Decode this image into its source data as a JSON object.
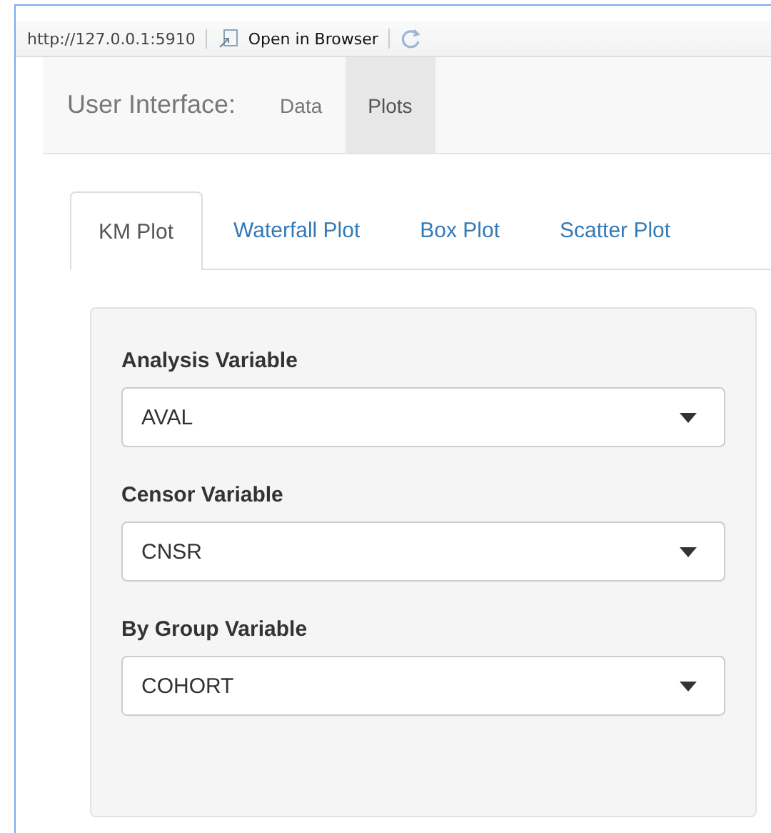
{
  "toolbar": {
    "url": "http://127.0.0.1:5910",
    "open_button": "Open in Browser"
  },
  "navbar": {
    "brand": "User Interface:",
    "items": [
      {
        "label": "Data",
        "selected": false
      },
      {
        "label": "Plots",
        "selected": true
      }
    ]
  },
  "tabs": [
    {
      "label": "KM Plot",
      "selected": true
    },
    {
      "label": "Waterfall Plot",
      "selected": false
    },
    {
      "label": "Box Plot",
      "selected": false
    },
    {
      "label": "Scatter Plot",
      "selected": false
    }
  ],
  "inputs": [
    {
      "label": "Analysis Variable",
      "value": "AVAL"
    },
    {
      "label": "Censor Variable",
      "value": "CNSR"
    },
    {
      "label": "By Group Variable",
      "value": "COHORT"
    }
  ]
}
